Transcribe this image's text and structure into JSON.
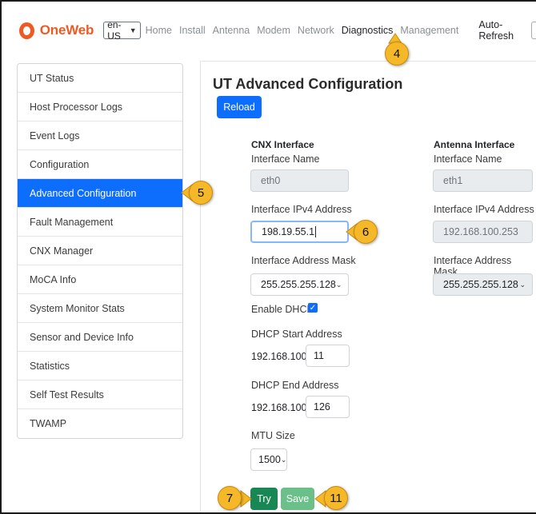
{
  "navbar": {
    "brand": "OneWeb",
    "lang": "en-US",
    "links": [
      "Home",
      "Install",
      "Antenna",
      "Modem",
      "Network",
      "Diagnostics",
      "Management"
    ],
    "active_link": "Diagnostics",
    "auto_refresh_label": "Auto-Refresh"
  },
  "sidebar": {
    "items": [
      {
        "label": "UT Status"
      },
      {
        "label": "Host Processor Logs"
      },
      {
        "label": "Event Logs"
      },
      {
        "label": "Configuration"
      },
      {
        "label": "Advanced Configuration"
      },
      {
        "label": "Fault Management"
      },
      {
        "label": "CNX Manager"
      },
      {
        "label": "MoCA Info"
      },
      {
        "label": "System Monitor Stats"
      },
      {
        "label": "Sensor and Device Info"
      },
      {
        "label": "Statistics"
      },
      {
        "label": "Self Test Results"
      },
      {
        "label": "TWAMP"
      }
    ],
    "active_index": 4
  },
  "main": {
    "title": "UT Advanced Configuration",
    "reload_label": "Reload",
    "cnx": {
      "heading": "CNX Interface",
      "name_label": "Interface Name",
      "name_value": "eth0",
      "ipv4_label": "Interface IPv4 Address",
      "ipv4_value": "198.19.55.1",
      "mask_label": "Interface Address Mask",
      "mask_value": "255.255.255.128",
      "dhcp_label": "Enable DHCP",
      "dhcp_enabled": true,
      "dhcp_start_label": "DHCP Start Address",
      "dhcp_start_prefix": "192.168.100.",
      "dhcp_start_value": "11",
      "dhcp_end_label": "DHCP End Address",
      "dhcp_end_prefix": "192.168.100.",
      "dhcp_end_value": "126",
      "mtu_label": "MTU Size",
      "mtu_value": "1500"
    },
    "antenna": {
      "heading": "Antenna Interface",
      "name_label": "Interface Name",
      "name_value": "eth1",
      "ipv4_label": "Interface IPv4 Address",
      "ipv4_value": "192.168.100.253",
      "mask_label": "Interface Address Mask",
      "mask_value": "255.255.255.128"
    },
    "try_label": "Try",
    "save_label": "Save"
  },
  "callouts": [
    "4",
    "5",
    "6",
    "7",
    "11"
  ],
  "colors": {
    "brand": "#ee5a24",
    "primary": "#0d6efd",
    "success": "#198754",
    "callout": "#f5b829"
  }
}
